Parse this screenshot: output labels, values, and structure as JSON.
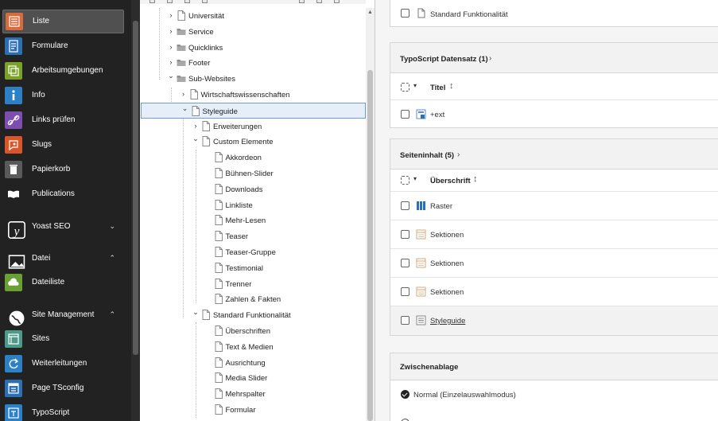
{
  "sidebar": {
    "items": [
      {
        "label": "Liste",
        "icon": "list-module-icon",
        "color": "#d96a3b",
        "active": true
      },
      {
        "label": "Formulare",
        "icon": "form-module-icon",
        "color": "#2c6fb3"
      },
      {
        "label": "Arbeitsumgebungen",
        "icon": "workspaces-module-icon",
        "color": "#7aa128"
      },
      {
        "label": "Info",
        "icon": "info-module-icon",
        "color": "#2c80c6"
      },
      {
        "label": "Links prüfen",
        "icon": "linkvalidator-module-icon",
        "color": "#7b4eb0"
      },
      {
        "label": "Slugs",
        "icon": "slugs-module-icon",
        "color": "#d9562b"
      },
      {
        "label": "Papierkorb",
        "icon": "recycler-module-icon",
        "color": "#5a5a5a"
      },
      {
        "label": "Publications",
        "icon": "book-module-icon",
        "color": "#222222"
      },
      {
        "label": "Yoast SEO",
        "icon": "yoast-icon",
        "group": true,
        "chevron": "down"
      },
      {
        "label": "Datei",
        "icon": "image-group-icon",
        "group": true,
        "chevron": "up"
      },
      {
        "label": "Dateiliste",
        "icon": "filelist-module-icon",
        "color": "#6aa033"
      },
      {
        "label": "Site Management",
        "icon": "globe-group-icon",
        "group": true,
        "chevron": "up"
      },
      {
        "label": "Sites",
        "icon": "sites-module-icon",
        "color": "#4b9a8a"
      },
      {
        "label": "Weiterleitungen",
        "icon": "redirects-module-icon",
        "color": "#2c80c6"
      },
      {
        "label": "Page TSconfig",
        "icon": "tsconfig-module-icon",
        "color": "#2c6fb3"
      },
      {
        "label": "TypoScript",
        "icon": "typoscript-module-icon",
        "color": "#2c80c6"
      }
    ]
  },
  "tree": {
    "nodes": [
      {
        "label": "Universität",
        "level": 0,
        "toggle": "right",
        "icon": "page-icon"
      },
      {
        "label": "Service",
        "level": 0,
        "toggle": "right",
        "icon": "folder-icon"
      },
      {
        "label": "Quicklinks",
        "level": 0,
        "toggle": "right",
        "icon": "folder-icon"
      },
      {
        "label": "Footer",
        "level": 0,
        "toggle": "right",
        "icon": "folder-icon"
      },
      {
        "label": "Sub-Websites",
        "level": 0,
        "toggle": "down",
        "icon": "folder-icon"
      },
      {
        "label": "Wirtschaftswissenschaften",
        "level": 1,
        "toggle": "right",
        "icon": "page-icon"
      },
      {
        "label": "Styleguide",
        "level": 1,
        "toggle": "down",
        "icon": "page-icon",
        "selected": true
      },
      {
        "label": "Erweiterungen",
        "level": 2,
        "toggle": "right",
        "icon": "page-icon"
      },
      {
        "label": "Custom Elemente",
        "level": 2,
        "toggle": "down",
        "icon": "page-icon"
      },
      {
        "label": "Akkordeon",
        "level": 3,
        "toggle": "",
        "icon": "page-icon"
      },
      {
        "label": "Bühnen-Slider",
        "level": 3,
        "toggle": "",
        "icon": "page-icon"
      },
      {
        "label": "Downloads",
        "level": 3,
        "toggle": "",
        "icon": "page-icon"
      },
      {
        "label": "Linkliste",
        "level": 3,
        "toggle": "",
        "icon": "page-icon"
      },
      {
        "label": "Mehr-Lesen",
        "level": 3,
        "toggle": "",
        "icon": "page-icon"
      },
      {
        "label": "Teaser",
        "level": 3,
        "toggle": "",
        "icon": "page-icon"
      },
      {
        "label": "Teaser-Gruppe",
        "level": 3,
        "toggle": "",
        "icon": "page-icon"
      },
      {
        "label": "Testimonial",
        "level": 3,
        "toggle": "",
        "icon": "page-icon"
      },
      {
        "label": "Trenner",
        "level": 3,
        "toggle": "",
        "icon": "page-icon"
      },
      {
        "label": "Zahlen & Fakten",
        "level": 3,
        "toggle": "",
        "icon": "page-icon"
      },
      {
        "label": "Standard Funktionalität",
        "level": 2,
        "toggle": "down",
        "icon": "page-icon"
      },
      {
        "label": "Überschriften",
        "level": 3,
        "toggle": "",
        "icon": "page-icon"
      },
      {
        "label": "Text & Medien",
        "level": 3,
        "toggle": "",
        "icon": "page-icon"
      },
      {
        "label": "Ausrichtung",
        "level": 3,
        "toggle": "",
        "icon": "page-icon"
      },
      {
        "label": "Media Slider",
        "level": 3,
        "toggle": "",
        "icon": "page-icon"
      },
      {
        "label": "Mehrspalter",
        "level": 3,
        "toggle": "",
        "icon": "page-icon"
      },
      {
        "label": "Formular",
        "level": 3,
        "toggle": "",
        "icon": "page-icon"
      }
    ]
  },
  "main": {
    "top_panel": {
      "row_label": "Standard Funktionalität"
    },
    "typoscript_panel": {
      "title": "TypoScript Datensatz (1)",
      "column": "Titel",
      "rows": [
        {
          "label": "+ext",
          "icon": "typoscript-record-icon"
        }
      ]
    },
    "content_panel": {
      "title": "Seiteninhalt (5)",
      "column": "Überschrift",
      "rows": [
        {
          "label": "Raster",
          "icon": "grid-content-icon"
        },
        {
          "label": "Sektionen",
          "icon": "section-content-icon"
        },
        {
          "label": "Sektionen",
          "icon": "section-content-icon"
        },
        {
          "label": "Sektionen",
          "icon": "section-content-icon"
        },
        {
          "label": "Styleguide",
          "icon": "text-content-icon",
          "highlight": true
        }
      ]
    },
    "clipboard_panel": {
      "title": "Zwischenablage",
      "mode_label": "Normal (Einzelauswahlmodus)"
    }
  }
}
